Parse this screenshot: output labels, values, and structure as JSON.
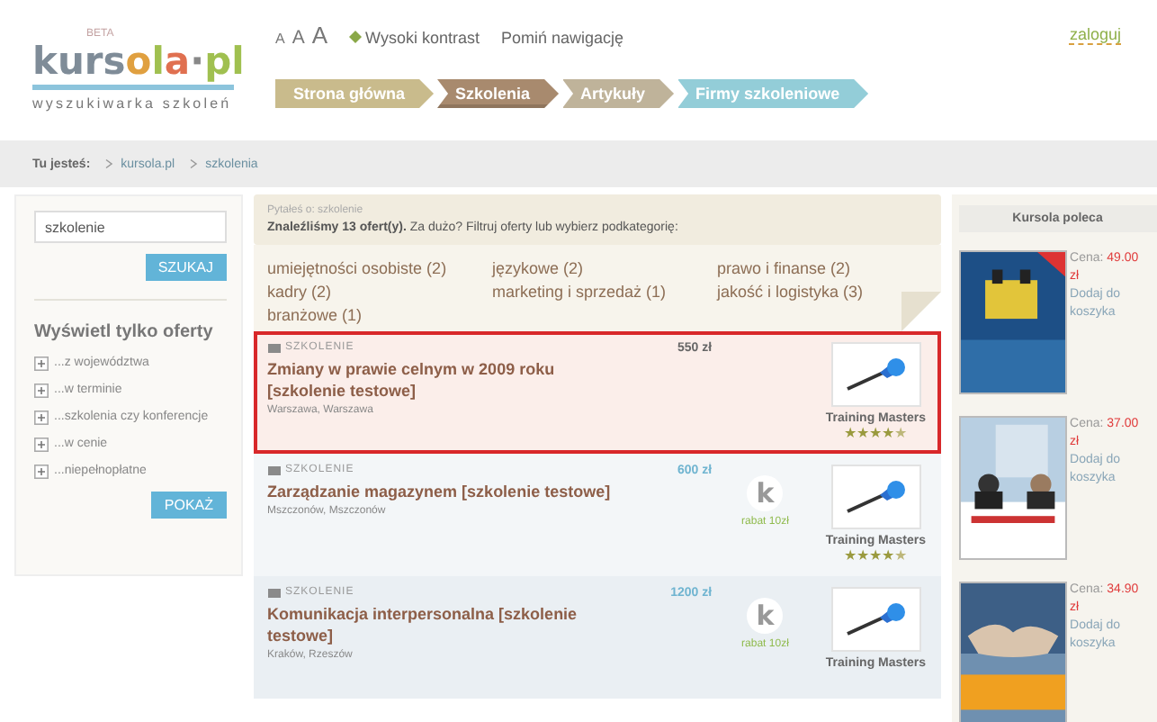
{
  "logo": {
    "badge": "BETA",
    "name": "kursola·pl",
    "tagline": "wyszukiwarka szkoleń"
  },
  "font_sizes": [
    "A",
    "A",
    "A"
  ],
  "top_links": [
    {
      "label": "Wysoki kontrast",
      "kind": "contrast"
    },
    {
      "label": "Pomiń nawigację",
      "kind": "plain"
    }
  ],
  "login": "zaloguj",
  "nav": [
    {
      "label": "Strona główna",
      "selected": false,
      "color": "#c9bb8c"
    },
    {
      "label": "Szkolenia",
      "selected": true,
      "color": "#a88a6e"
    },
    {
      "label": "Artykuły",
      "selected": false,
      "color": "#bfb39a"
    },
    {
      "label": "Firmy szkoleniowe",
      "selected": false,
      "color": "#93cdd8"
    }
  ],
  "breadcrumb": {
    "label": "Tu jesteś:",
    "items": [
      "kursola.pl",
      "szkolenia"
    ]
  },
  "sidebar": {
    "search": {
      "value": "szkolenie"
    },
    "search_button": "SZUKAJ",
    "heading": "Wyświetl tylko oferty",
    "filters": [
      {
        "label": "...z województwa",
        "expanded": false
      },
      {
        "label": "...w terminie",
        "expanded": false
      },
      {
        "label": "...szkolenia czy konferencje",
        "expanded": false
      },
      {
        "label": "...w cenie",
        "expanded": false
      },
      {
        "label": "...niepełnopłatne",
        "expanded": false
      }
    ],
    "show_button": "POKAŻ"
  },
  "query": {
    "asked": "Pytałeś o: szkolenie",
    "summary": "**Znaleźliśmy 13 ofert(y).** Za dużo? Filtruj oferty lub wybierz podkategorię:"
  },
  "categories": [
    "umiejętności osobiste (2)",
    "językowe (2)",
    "prawo i finanse (2)",
    "kadry (2)",
    "marketing i sprzedaż (1)",
    "jakość i logistyka (3)",
    "branżowe (1)"
  ],
  "results": [
    {
      "type": "SZKOLENIE",
      "title": "Zmiany w prawie celnym w 2009 roku [szkolenie testowe]",
      "location": "Warszawa, Warszawa",
      "price": "550 zł",
      "highlighted": true,
      "company": "Training Masters",
      "stars": 4
    },
    {
      "type": "SZKOLENIE",
      "title": "Zarządzanie magazynem [szkolenie testowe]",
      "location": "Mszczonów, Mszczonów",
      "price": "600 zł",
      "highlighted": false,
      "discount": {
        "letter": "k",
        "label": "rabat 10zł"
      },
      "company": "Training Masters",
      "stars": 4
    },
    {
      "type": "SZKOLENIE",
      "title": "Komunikacja interpersonalna [szkolenie testowe]",
      "location": "Kraków, Rzeszów",
      "price": "1200 zł",
      "highlighted": false,
      "discount": {
        "letter": "k",
        "label": "rabat 10zł"
      },
      "company": "Training Masters"
    }
  ],
  "recommended": {
    "title": "Kursola poleca",
    "books": [
      {
        "price_label": "Cena:",
        "price": "49.00",
        "currency": "zł",
        "action": "Dodaj do koszyka"
      },
      {
        "price_label": "Cena:",
        "price": "37.00",
        "currency": "zł",
        "action": "Dodaj do koszyka"
      },
      {
        "price_label": "Cena:",
        "price": "34.90",
        "currency": "zł",
        "action": "Dodaj do koszyka"
      }
    ]
  }
}
